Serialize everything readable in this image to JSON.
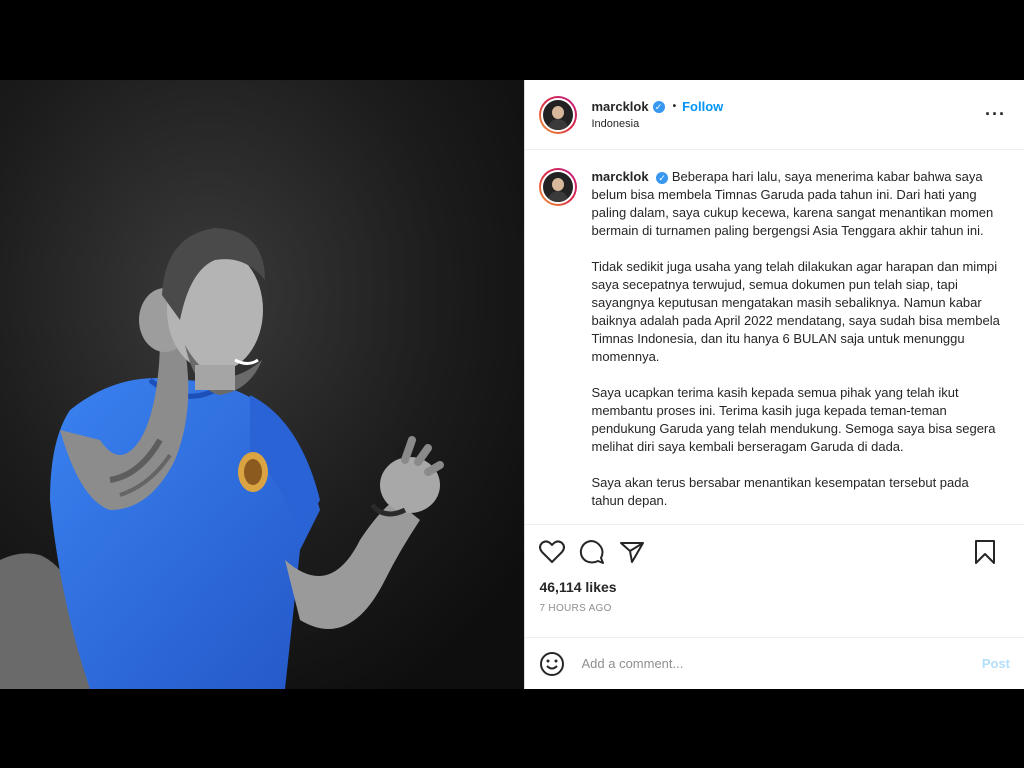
{
  "header": {
    "username": "marcklok",
    "follow_label": "Follow",
    "separator": "•",
    "location": "Indonesia",
    "more_icon": "more-horizontal-icon",
    "verified_icon": "verified-badge-icon"
  },
  "caption": {
    "username": "marcklok",
    "paragraphs": [
      "Beberapa hari lalu, saya menerima kabar bahwa saya belum bisa membela Timnas Garuda pada tahun ini. Dari hati yang paling dalam, saya cukup kecewa, karena sangat menantikan momen bermain di turnamen paling bergengsi Asia Tenggara akhir tahun ini.",
      "Tidak sedikit juga usaha yang telah dilakukan agar harapan dan mimpi saya secepatnya terwujud, semua dokumen pun telah siap, tapi sayangnya keputusan mengatakan masih sebaliknya. Namun kabar baiknya adalah pada April 2022 mendatang, saya sudah bisa membela Timnas Indonesia, dan itu hanya 6 BULAN saja untuk menunggu momennya.",
      "Saya ucapkan terima kasih kepada semua pihak yang telah ikut membantu proses ini. Terima kasih juga kepada teman-teman pendukung Garuda yang telah mendukung. Semoga saya bisa segera melihat diri saya kembali berseragam Garuda di dada.",
      "Saya akan terus bersabar menantikan kesempatan tersebut pada tahun depan."
    ]
  },
  "actions": {
    "like_icon": "heart-icon",
    "comment_icon": "comment-icon",
    "share_icon": "share-icon",
    "save_icon": "bookmark-icon",
    "likes": "46,114 likes",
    "time": "7 HOURS AGO"
  },
  "comment": {
    "emoji_icon": "emoji-icon",
    "placeholder": "Add a comment...",
    "post_label": "Post"
  },
  "colors": {
    "accent": "#0095f6",
    "jersey": "#2f6fe0",
    "post_disabled": "#b2dffc"
  }
}
